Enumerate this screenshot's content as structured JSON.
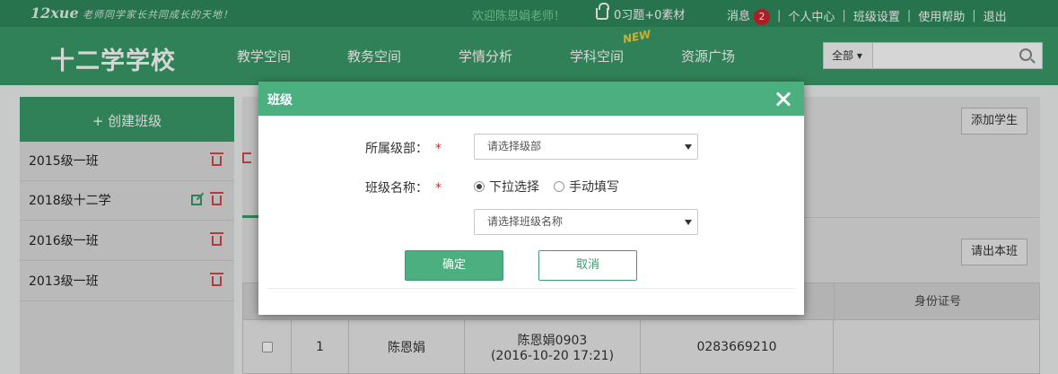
{
  "topbar": {
    "logo": "12xue",
    "slogan": "老师同学家长共同成长的天地！",
    "welcome": "欢迎陈恩娟老师！",
    "basket": "0习题+0素材",
    "messages_label": "消息",
    "messages_count": "2",
    "links": [
      "个人中心",
      "班级设置",
      "使用帮助",
      "退出"
    ]
  },
  "nav": {
    "school": "十二学学校",
    "items": [
      "教学空间",
      "教务空间",
      "学情分析",
      "学科空间",
      "资源广场"
    ],
    "new_tag": "NEW",
    "search": {
      "scope": "全部",
      "placeholder": ""
    }
  },
  "sidebar": {
    "create_label": "+ 创建班级",
    "classes": [
      {
        "name": "2015级一班"
      },
      {
        "name": "2018级十二学"
      },
      {
        "name": "2016级一班"
      },
      {
        "name": "2013级一班"
      }
    ]
  },
  "main": {
    "add_student": "添加学生",
    "export_class": "请出本班",
    "table": {
      "header_id": "身份证号",
      "row": {
        "index": "1",
        "name": "陈恩娟",
        "account": "陈恩娟0903",
        "created": "(2016-10-20 17:21)",
        "number": "0283669210"
      }
    }
  },
  "modal": {
    "title": "班级",
    "grade_label": "所属级部：",
    "grade_placeholder": "请选择级部",
    "name_label": "班级名称：",
    "required_mark": "*",
    "radio_dropdown": "下拉选择",
    "radio_manual": "手动填写",
    "name_placeholder": "请选择班级名称",
    "ok": "确定",
    "cancel": "取消"
  },
  "colors": {
    "brand_dark": "#2f8a5c",
    "brand": "#3b9a69",
    "modal_accent": "#4caf80",
    "danger": "#d04b4b"
  }
}
